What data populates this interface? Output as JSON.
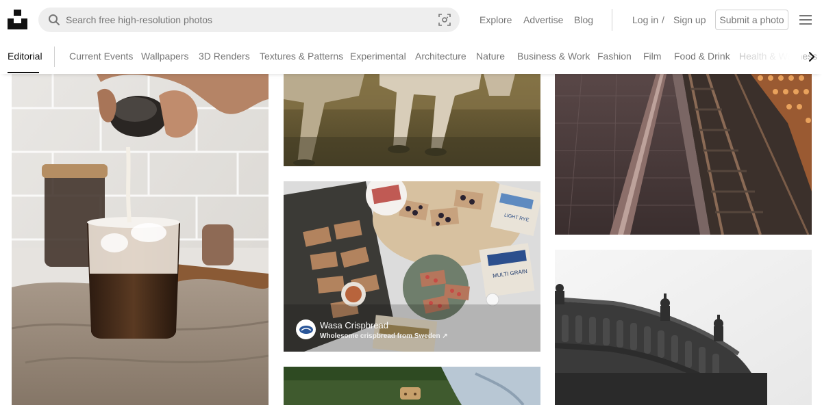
{
  "header": {
    "search_placeholder": "Search free high-resolution photos",
    "links": {
      "explore": "Explore",
      "advertise": "Advertise",
      "blog": "Blog",
      "login": "Log in",
      "slash": "/",
      "signup": "Sign up"
    },
    "submit_label": "Submit a photo"
  },
  "topics": [
    "Editorial",
    "Current Events",
    "Wallpapers",
    "3D Renders",
    "Textures & Patterns",
    "Experimental",
    "Architecture",
    "Nature",
    "Business & Work",
    "Fashion",
    "Film",
    "Food & Drink",
    "Health & Wellness"
  ],
  "sponsored": {
    "name": "Wasa Crispbread",
    "subtitle": "Wholesome crispbread from Sweden ↗",
    "avatar_text": "Wasa"
  },
  "packages": {
    "light_rye": "LIGHT RYE",
    "multigrain": "MULTI GRAIN",
    "brand": "Wasa"
  },
  "colors": {
    "accent": "#111111",
    "muted": "#767676",
    "search_bg": "#eeeeee",
    "border": "#d1d1d1"
  },
  "icons": [
    "unsplash-logo",
    "search-icon",
    "visual-search-icon",
    "menu-icon",
    "chevron-right-icon"
  ]
}
